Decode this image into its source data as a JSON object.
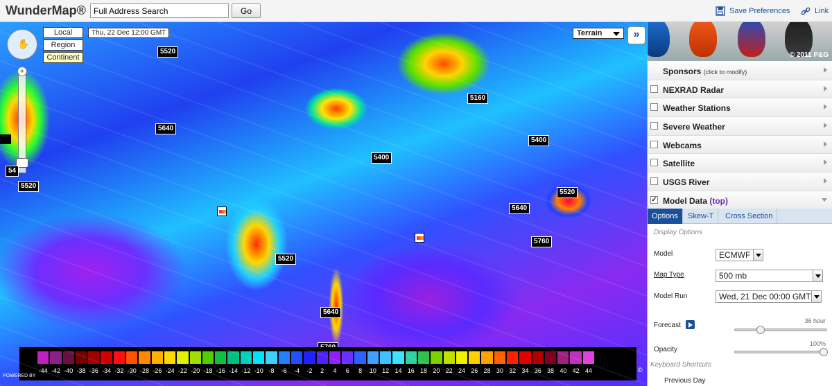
{
  "topbar": {
    "logo": "WunderMap®",
    "search_value": "Full Address Search",
    "go_label": "Go",
    "save_prefs": "Save Preferences",
    "link": "Link"
  },
  "map": {
    "view_buttons": [
      "Local",
      "Region",
      "Continent"
    ],
    "active_view": "Continent",
    "date": "Thu, 22 Dec 12:00 GMT",
    "base_layer": "Terrain",
    "expand_label": "»",
    "contours": [
      "5520",
      "5640",
      "5520",
      "5160",
      "5400",
      "5400",
      "5520",
      "5640",
      "5760",
      "5520",
      "5640",
      "5760",
      "54"
    ],
    "powered_by": "POWERED BY"
  },
  "legend": {
    "values": [
      "-44",
      "-42",
      "-40",
      "-38",
      "-36",
      "-34",
      "-32",
      "-30",
      "-28",
      "-26",
      "-24",
      "-22",
      "-20",
      "-18",
      "-16",
      "-14",
      "-12",
      "-10",
      "-8",
      "-6",
      "-4",
      "-2",
      "2",
      "4",
      "6",
      "8",
      "10",
      "12",
      "14",
      "16",
      "18",
      "20",
      "22",
      "24",
      "26",
      "28",
      "30",
      "32",
      "34",
      "36",
      "38",
      "40",
      "42",
      "44"
    ],
    "colors": [
      "#c020c0",
      "#8a208a",
      "#6a1040",
      "#7a0000",
      "#a00000",
      "#d00000",
      "#ff1010",
      "#ff5000",
      "#ff8800",
      "#ffb000",
      "#ffd800",
      "#e0f000",
      "#a0e000",
      "#50d000",
      "#10c040",
      "#00c080",
      "#00d0c0",
      "#00e0ff",
      "#40d0ff",
      "#2080ff",
      "#2050ff",
      "#2020ff",
      "#5020ff",
      "#9020ff",
      "#6a30ff",
      "#3060ff",
      "#40a0ff",
      "#40c0ff",
      "#40e0ff",
      "#30d0a0",
      "#30c050",
      "#80d000",
      "#c0e000",
      "#f0f000",
      "#ffd000",
      "#ffa000",
      "#ff6000",
      "#ff2000",
      "#e00000",
      "#b00000",
      "#800020",
      "#a02080",
      "#c030c0",
      "#e040e0"
    ],
    "copy": "©"
  },
  "sidebar": {
    "banner_copy": "© 2011 P&G",
    "sponsors_label": "Sponsors",
    "sponsors_hint": "(click to modify)",
    "layers": [
      {
        "name": "NEXRAD Radar",
        "checked": false
      },
      {
        "name": "Weather Stations",
        "checked": false
      },
      {
        "name": "Severe Weather",
        "checked": false
      },
      {
        "name": "Webcams",
        "checked": false
      },
      {
        "name": "Satellite",
        "checked": false
      },
      {
        "name": "USGS River",
        "checked": false
      }
    ],
    "model_data": {
      "name": "Model Data",
      "top": "(top)",
      "checked": true
    },
    "tabs": [
      "Options",
      "Skew-T",
      "Cross Section"
    ],
    "active_tab": "Options",
    "options": {
      "display_options": "Display Options",
      "model_label": "Model",
      "model_value": "ECMWF",
      "map_type_label": "Map Type",
      "map_type_value": "500 mb",
      "model_run_label": "Model Run",
      "model_run_value": "Wed, 21 Dec 00:00 GMT",
      "forecast_label": "Forecast",
      "forecast_value": "36 hour",
      "forecast_fraction": 0.25,
      "opacity_label": "Opacity",
      "opacity_value": "100%",
      "opacity_fraction": 1.0,
      "keyboard_shortcuts": "Keyboard Shortcuts",
      "previous_day": "Previous Day"
    }
  }
}
